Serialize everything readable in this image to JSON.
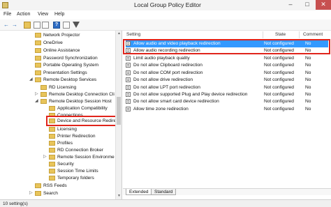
{
  "window": {
    "title": "Local Group Policy Editor",
    "minimize_glyph": "–",
    "maximize_glyph": "□",
    "close_glyph": "✕"
  },
  "menu": {
    "items": [
      "File",
      "Action",
      "View",
      "Help"
    ]
  },
  "toolbar": {
    "back_glyph": "←",
    "forward_glyph": "→",
    "help_glyph": "?"
  },
  "tree": {
    "items": [
      {
        "label": "Network Projector",
        "toggle": ""
      },
      {
        "label": "OneDrive",
        "toggle": ""
      },
      {
        "label": "Online Assistance",
        "toggle": ""
      },
      {
        "label": "Password Synchronization",
        "toggle": ""
      },
      {
        "label": "Portable Operating System",
        "toggle": ""
      },
      {
        "label": "Presentation Settings",
        "toggle": ""
      },
      {
        "label": "Remote Desktop Services",
        "toggle": "◢"
      },
      {
        "label": "RD Licensing",
        "toggle": ""
      },
      {
        "label": "Remote Desktop Connection Cli",
        "toggle": "▷"
      },
      {
        "label": "Remote Desktop Session Host",
        "toggle": "◢"
      },
      {
        "label": "Application Compatibility",
        "toggle": ""
      },
      {
        "label": "Connections",
        "toggle": ""
      },
      {
        "label": "Device and Resource Redirec",
        "toggle": ""
      },
      {
        "label": "Licensing",
        "toggle": ""
      },
      {
        "label": "Printer Redirection",
        "toggle": ""
      },
      {
        "label": "Profiles",
        "toggle": ""
      },
      {
        "label": "RD Connection Broker",
        "toggle": ""
      },
      {
        "label": "Remote Session Environme",
        "toggle": "▷"
      },
      {
        "label": "Security",
        "toggle": ""
      },
      {
        "label": "Session Time Limits",
        "toggle": ""
      },
      {
        "label": "Temporary folders",
        "toggle": ""
      },
      {
        "label": "RSS Feeds",
        "toggle": ""
      },
      {
        "label": "Search",
        "toggle": "▷"
      }
    ]
  },
  "list": {
    "headers": {
      "setting": "Setting",
      "state": "State",
      "comment": "Comment"
    },
    "rows": [
      {
        "setting": "Allow audio and video playback redirection",
        "state": "Not configured",
        "comment": "No"
      },
      {
        "setting": "Allow audio recording redirection",
        "state": "Not configured",
        "comment": "No"
      },
      {
        "setting": "Limit audio playback quality",
        "state": "Not configured",
        "comment": "No"
      },
      {
        "setting": "Do not allow Clipboard redirection",
        "state": "Not configured",
        "comment": "No"
      },
      {
        "setting": "Do not allow COM port redirection",
        "state": "Not configured",
        "comment": "No"
      },
      {
        "setting": "Do not allow drive redirection",
        "state": "Not configured",
        "comment": "No"
      },
      {
        "setting": "Do not allow LPT port redirection",
        "state": "Not configured",
        "comment": "No"
      },
      {
        "setting": "Do not allow supported Plug and Play device redirection",
        "state": "Not configured",
        "comment": "No"
      },
      {
        "setting": "Do not allow smart card device redirection",
        "state": "Not configured",
        "comment": "No"
      },
      {
        "setting": "Allow time zone redirection",
        "state": "Not configured",
        "comment": "No"
      }
    ]
  },
  "tabs": [
    "Extended",
    "Standard"
  ],
  "status": {
    "text": "10 setting(s)"
  },
  "colors": {
    "highlight": "#e0241b",
    "selection": "#3399ff"
  }
}
